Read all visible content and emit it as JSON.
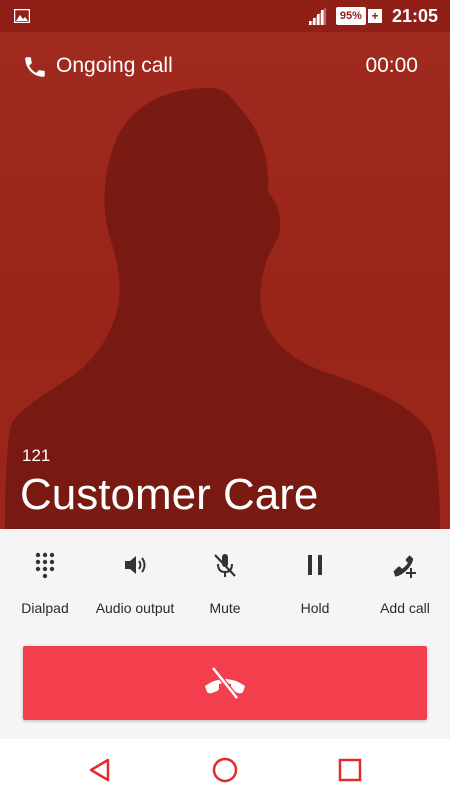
{
  "status_bar": {
    "battery_percent": "95%",
    "charging_symbol": "+",
    "time": "21:05",
    "icons": [
      "image-icon",
      "signal-icon",
      "battery-icon"
    ]
  },
  "call": {
    "status": "Ongoing call",
    "timer": "00:00",
    "number": "121",
    "name": "Customer Care"
  },
  "controls": [
    {
      "label": "Dialpad",
      "icon": "dialpad-icon"
    },
    {
      "label": "Audio output",
      "icon": "speaker-icon"
    },
    {
      "label": "Mute",
      "icon": "mic-off-icon"
    },
    {
      "label": "Hold",
      "icon": "pause-icon"
    },
    {
      "label": "Add call",
      "icon": "add-call-icon"
    }
  ],
  "end_call": {
    "icon": "end-call-icon"
  },
  "nav": {
    "icons": [
      "back-icon",
      "home-icon",
      "recents-icon"
    ]
  },
  "colors": {
    "hero_red": "#9b261b",
    "status_bar": "#8f1f17",
    "end_call": "#f23e4d",
    "nav_accent": "#e32b2b"
  }
}
